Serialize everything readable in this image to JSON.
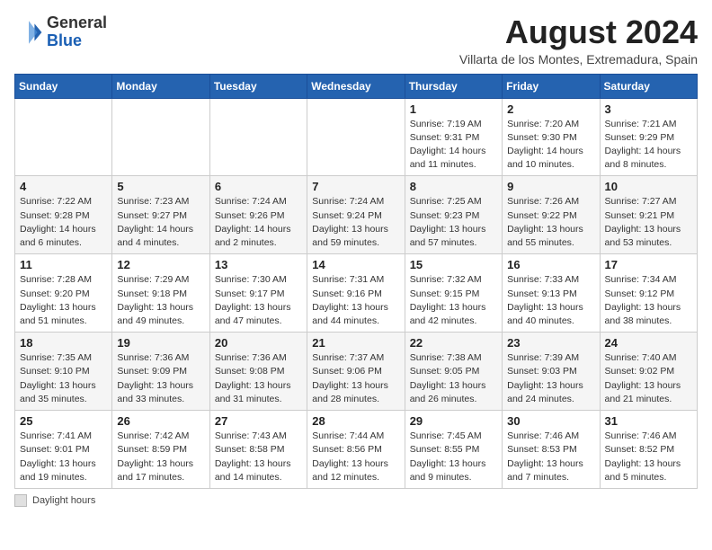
{
  "header": {
    "logo_general": "General",
    "logo_blue": "Blue",
    "month_year": "August 2024",
    "location": "Villarta de los Montes, Extremadura, Spain"
  },
  "days_of_week": [
    "Sunday",
    "Monday",
    "Tuesday",
    "Wednesday",
    "Thursday",
    "Friday",
    "Saturday"
  ],
  "weeks": [
    [
      {
        "day": "",
        "info": ""
      },
      {
        "day": "",
        "info": ""
      },
      {
        "day": "",
        "info": ""
      },
      {
        "day": "",
        "info": ""
      },
      {
        "day": "1",
        "info": "Sunrise: 7:19 AM\nSunset: 9:31 PM\nDaylight: 14 hours and 11 minutes."
      },
      {
        "day": "2",
        "info": "Sunrise: 7:20 AM\nSunset: 9:30 PM\nDaylight: 14 hours and 10 minutes."
      },
      {
        "day": "3",
        "info": "Sunrise: 7:21 AM\nSunset: 9:29 PM\nDaylight: 14 hours and 8 minutes."
      }
    ],
    [
      {
        "day": "4",
        "info": "Sunrise: 7:22 AM\nSunset: 9:28 PM\nDaylight: 14 hours and 6 minutes."
      },
      {
        "day": "5",
        "info": "Sunrise: 7:23 AM\nSunset: 9:27 PM\nDaylight: 14 hours and 4 minutes."
      },
      {
        "day": "6",
        "info": "Sunrise: 7:24 AM\nSunset: 9:26 PM\nDaylight: 14 hours and 2 minutes."
      },
      {
        "day": "7",
        "info": "Sunrise: 7:24 AM\nSunset: 9:24 PM\nDaylight: 13 hours and 59 minutes."
      },
      {
        "day": "8",
        "info": "Sunrise: 7:25 AM\nSunset: 9:23 PM\nDaylight: 13 hours and 57 minutes."
      },
      {
        "day": "9",
        "info": "Sunrise: 7:26 AM\nSunset: 9:22 PM\nDaylight: 13 hours and 55 minutes."
      },
      {
        "day": "10",
        "info": "Sunrise: 7:27 AM\nSunset: 9:21 PM\nDaylight: 13 hours and 53 minutes."
      }
    ],
    [
      {
        "day": "11",
        "info": "Sunrise: 7:28 AM\nSunset: 9:20 PM\nDaylight: 13 hours and 51 minutes."
      },
      {
        "day": "12",
        "info": "Sunrise: 7:29 AM\nSunset: 9:18 PM\nDaylight: 13 hours and 49 minutes."
      },
      {
        "day": "13",
        "info": "Sunrise: 7:30 AM\nSunset: 9:17 PM\nDaylight: 13 hours and 47 minutes."
      },
      {
        "day": "14",
        "info": "Sunrise: 7:31 AM\nSunset: 9:16 PM\nDaylight: 13 hours and 44 minutes."
      },
      {
        "day": "15",
        "info": "Sunrise: 7:32 AM\nSunset: 9:15 PM\nDaylight: 13 hours and 42 minutes."
      },
      {
        "day": "16",
        "info": "Sunrise: 7:33 AM\nSunset: 9:13 PM\nDaylight: 13 hours and 40 minutes."
      },
      {
        "day": "17",
        "info": "Sunrise: 7:34 AM\nSunset: 9:12 PM\nDaylight: 13 hours and 38 minutes."
      }
    ],
    [
      {
        "day": "18",
        "info": "Sunrise: 7:35 AM\nSunset: 9:10 PM\nDaylight: 13 hours and 35 minutes."
      },
      {
        "day": "19",
        "info": "Sunrise: 7:36 AM\nSunset: 9:09 PM\nDaylight: 13 hours and 33 minutes."
      },
      {
        "day": "20",
        "info": "Sunrise: 7:36 AM\nSunset: 9:08 PM\nDaylight: 13 hours and 31 minutes."
      },
      {
        "day": "21",
        "info": "Sunrise: 7:37 AM\nSunset: 9:06 PM\nDaylight: 13 hours and 28 minutes."
      },
      {
        "day": "22",
        "info": "Sunrise: 7:38 AM\nSunset: 9:05 PM\nDaylight: 13 hours and 26 minutes."
      },
      {
        "day": "23",
        "info": "Sunrise: 7:39 AM\nSunset: 9:03 PM\nDaylight: 13 hours and 24 minutes."
      },
      {
        "day": "24",
        "info": "Sunrise: 7:40 AM\nSunset: 9:02 PM\nDaylight: 13 hours and 21 minutes."
      }
    ],
    [
      {
        "day": "25",
        "info": "Sunrise: 7:41 AM\nSunset: 9:01 PM\nDaylight: 13 hours and 19 minutes."
      },
      {
        "day": "26",
        "info": "Sunrise: 7:42 AM\nSunset: 8:59 PM\nDaylight: 13 hours and 17 minutes."
      },
      {
        "day": "27",
        "info": "Sunrise: 7:43 AM\nSunset: 8:58 PM\nDaylight: 13 hours and 14 minutes."
      },
      {
        "day": "28",
        "info": "Sunrise: 7:44 AM\nSunset: 8:56 PM\nDaylight: 13 hours and 12 minutes."
      },
      {
        "day": "29",
        "info": "Sunrise: 7:45 AM\nSunset: 8:55 PM\nDaylight: 13 hours and 9 minutes."
      },
      {
        "day": "30",
        "info": "Sunrise: 7:46 AM\nSunset: 8:53 PM\nDaylight: 13 hours and 7 minutes."
      },
      {
        "day": "31",
        "info": "Sunrise: 7:46 AM\nSunset: 8:52 PM\nDaylight: 13 hours and 5 minutes."
      }
    ]
  ],
  "footer": {
    "legend_label": "Daylight hours"
  }
}
